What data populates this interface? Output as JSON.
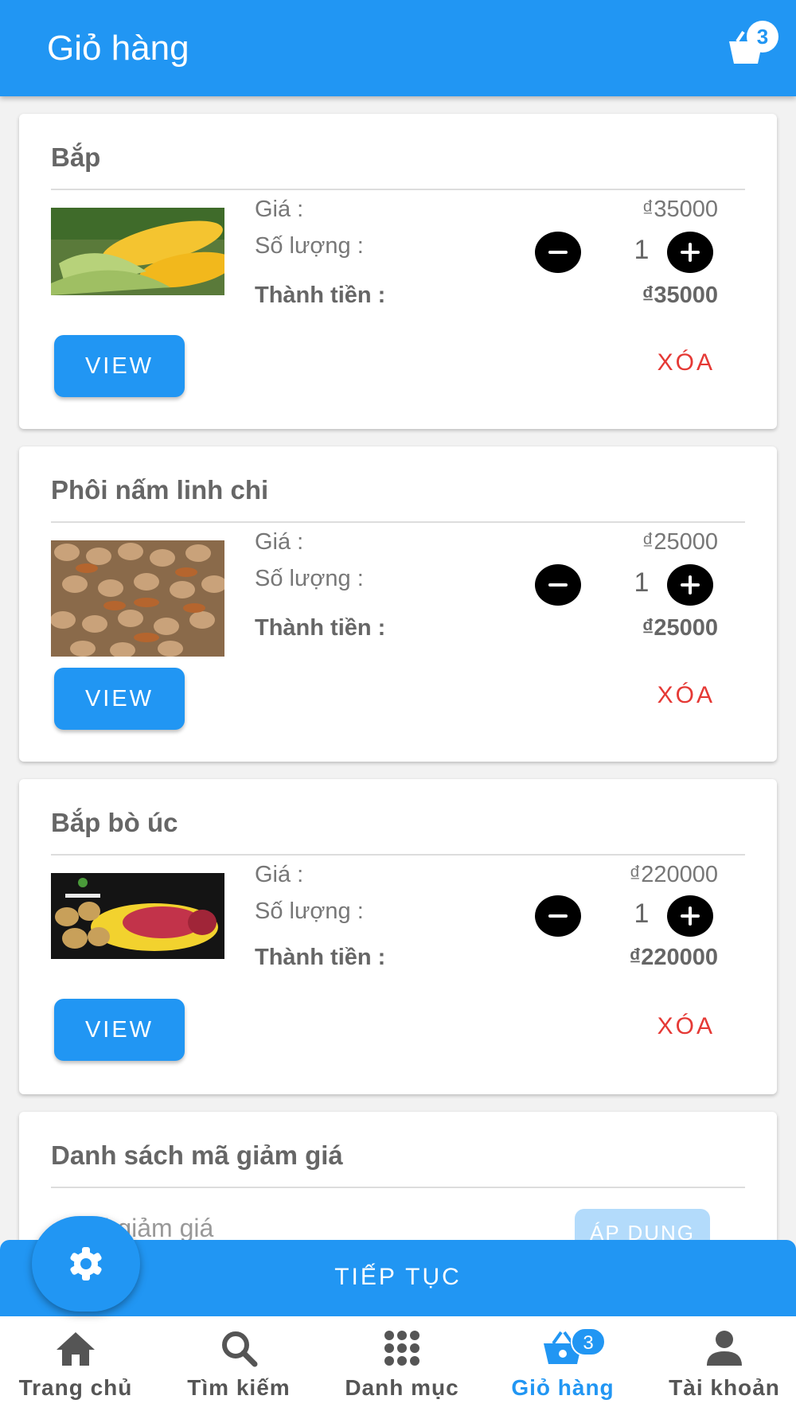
{
  "app_bar": {
    "title": "Giỏ hàng",
    "cart_badge": "3"
  },
  "cart_items": [
    {
      "name": "Bắp",
      "price_label": "Giá :",
      "price": "₫35000",
      "qty_label": "Số lượng :",
      "qty": "1",
      "total_label": "Thành tiền :",
      "total": "₫35000",
      "view_label": "VIEW",
      "delete_label": "XÓA"
    },
    {
      "name": "Phôi nấm linh chi",
      "price_label": "Giá :",
      "price": "₫25000",
      "qty_label": "Số lượng :",
      "qty": "1",
      "total_label": "Thành tiền :",
      "total": "₫25000",
      "view_label": "VIEW",
      "delete_label": "XÓA"
    },
    {
      "name": "Bắp bò úc",
      "price_label": "Giá :",
      "price": "₫220000",
      "qty_label": "Số lượng :",
      "qty": "1",
      "total_label": "Thành tiền :",
      "total": "₫220000",
      "view_label": "VIEW",
      "delete_label": "XÓA"
    }
  ],
  "coupon": {
    "title": "Danh sách mã giảm giá",
    "placeholder": "Mã giảm giá",
    "apply_label": "ÁP DỤNG"
  },
  "continue_label": "TIẾP TỤC",
  "bottom_nav": [
    {
      "label": "Trang chủ",
      "icon": "home-icon"
    },
    {
      "label": "Tìm kiếm",
      "icon": "search-icon"
    },
    {
      "label": "Danh mục",
      "icon": "grid-icon"
    },
    {
      "label": "Giỏ hàng",
      "icon": "basket-icon",
      "badge": "3",
      "active": true
    },
    {
      "label": "Tài khoản",
      "icon": "user-icon"
    }
  ],
  "colors": {
    "primary": "#2196f3",
    "danger": "#e53935"
  }
}
